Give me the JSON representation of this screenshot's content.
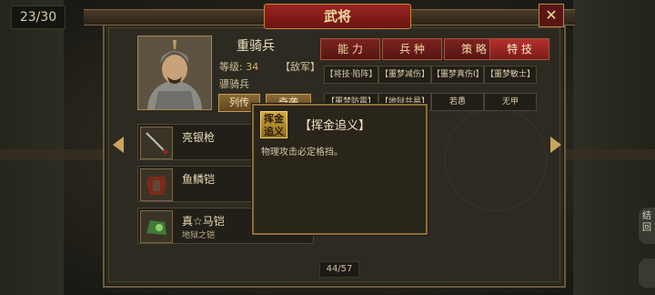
{
  "page_counter": "23/30",
  "dialog": {
    "title": "武将",
    "close_label": "✕"
  },
  "general": {
    "name": "重骑兵",
    "level_label": "等级:",
    "level_value": "34",
    "faction": "【敌军】",
    "unit_class": "骠骑兵",
    "biography_button": "列传",
    "second_button": "奇袭"
  },
  "tabs": [
    {
      "label": "能 力",
      "active": false
    },
    {
      "label": "兵 种",
      "active": false
    },
    {
      "label": "策 略",
      "active": false
    },
    {
      "label": "特 技",
      "active": true
    }
  ],
  "skills_row1": [
    "【将技·陷阵】",
    "【噩梦减伤】",
    "【噩梦真伤Ⅰ】",
    "【噩梦敏士】"
  ],
  "skills_row2": [
    "【噩梦防震】",
    "【地狱共易】",
    "若愚",
    "无甲"
  ],
  "equipment": [
    {
      "name": "亮银枪",
      "sub": ""
    },
    {
      "name": "鱼鳞铠",
      "sub": ""
    },
    {
      "name": "真☆马铠",
      "sub": "地狱之铠"
    }
  ],
  "tooltip": {
    "icon_text": "挥金\n追义",
    "title": "【挥金追义】",
    "description": "物理攻击必定格挡。"
  },
  "page_indicator": "44/57",
  "side_button_text": "结\n回"
}
